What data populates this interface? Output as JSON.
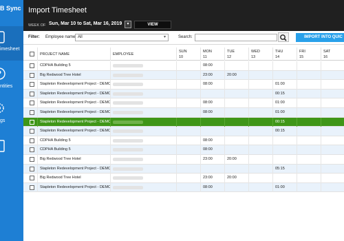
{
  "sidebar": {
    "app_title": "B Sync",
    "items": [
      {
        "label": "imesheet",
        "icon": "timesheet-icon",
        "active": true
      },
      {
        "label": "ntities",
        "icon": "entities-icon",
        "active": false
      },
      {
        "label": "gs",
        "icon": "settings-icon",
        "active": false
      },
      {
        "label": "",
        "icon": "document-icon",
        "active": false
      }
    ]
  },
  "header": {
    "title": "Import Timesheet",
    "week_of_label": "WEEK OF",
    "week_range": "Sun, Mar 10  to  Sat, Mar 16, 2019",
    "view_label": "VIEW"
  },
  "filter": {
    "label": "Filter:",
    "employee_label": "Employee name:",
    "employee_value": "All",
    "search_label": "Search:",
    "search_value": "",
    "import_label": "IMPORT INTO QUIC"
  },
  "table": {
    "columns": {
      "project": "PROJECT NAME",
      "employee": "EMPLOYEE",
      "days": [
        {
          "day": "SUN",
          "date": "10"
        },
        {
          "day": "MON",
          "date": "11"
        },
        {
          "day": "TUE",
          "date": "12"
        },
        {
          "day": "WED",
          "date": "13"
        },
        {
          "day": "THU",
          "date": "14"
        },
        {
          "day": "FRI",
          "date": "15"
        },
        {
          "day": "SAT",
          "date": "16"
        }
      ]
    },
    "rows": [
      {
        "project": "CDPHA Building 5",
        "hours": [
          "",
          "08:00",
          "",
          "",
          "",
          "",
          ""
        ],
        "selected": false
      },
      {
        "project": "Big Redwood Tree Hotel",
        "hours": [
          "",
          "23:00",
          "20:00",
          "",
          "",
          "",
          ""
        ],
        "selected": false
      },
      {
        "project": "Stapleton Redevelopment Project - DEMO",
        "hours": [
          "",
          "08:00",
          "",
          "",
          "01:00",
          "",
          ""
        ],
        "selected": false
      },
      {
        "project": "Stapleton Redevelopment Project - DEMO",
        "hours": [
          "",
          "",
          "",
          "",
          "00:15",
          "",
          ""
        ],
        "selected": false
      },
      {
        "project": "Stapleton Redevelopment Project - DEMO",
        "hours": [
          "",
          "08:00",
          "",
          "",
          "01:00",
          "",
          ""
        ],
        "selected": false
      },
      {
        "project": "Stapleton Redevelopment Project - DEMO",
        "hours": [
          "",
          "08:00",
          "",
          "",
          "01:00",
          "",
          ""
        ],
        "selected": false
      },
      {
        "project": "Stapleton Redevelopment Project - DEMO",
        "hours": [
          "",
          "",
          "",
          "",
          "00:15",
          "",
          ""
        ],
        "selected": true
      },
      {
        "project": "Stapleton Redevelopment Project - DEMO",
        "hours": [
          "",
          "",
          "",
          "",
          "00:15",
          "",
          ""
        ],
        "selected": false
      },
      {
        "project": "CDPHA Building 5",
        "hours": [
          "",
          "08:00",
          "",
          "",
          "",
          "",
          ""
        ],
        "selected": false
      },
      {
        "project": "CDPHA Building 5",
        "hours": [
          "",
          "08:00",
          "",
          "",
          "",
          "",
          ""
        ],
        "selected": false
      },
      {
        "project": "Big Redwood Tree Hotel",
        "hours": [
          "",
          "23:00",
          "20:00",
          "",
          "",
          "",
          ""
        ],
        "selected": false
      },
      {
        "project": "Stapleton Redevelopment Project - DEMO",
        "hours": [
          "",
          "",
          "",
          "",
          "05:15",
          "",
          ""
        ],
        "selected": false
      },
      {
        "project": "Big Redwood Tree Hotel",
        "hours": [
          "",
          "23:00",
          "20:00",
          "",
          "",
          "",
          ""
        ],
        "selected": false
      },
      {
        "project": "Stapleton Redevelopment Project - DEMO",
        "hours": [
          "",
          "08:00",
          "",
          "",
          "01:00",
          "",
          ""
        ],
        "selected": false
      }
    ]
  },
  "colors": {
    "sidebar": "#1e7fd4",
    "topbar": "#202020",
    "accent": "#29a1ea",
    "selected_row": "#3f9618",
    "alt_row": "#e9f2fb"
  }
}
